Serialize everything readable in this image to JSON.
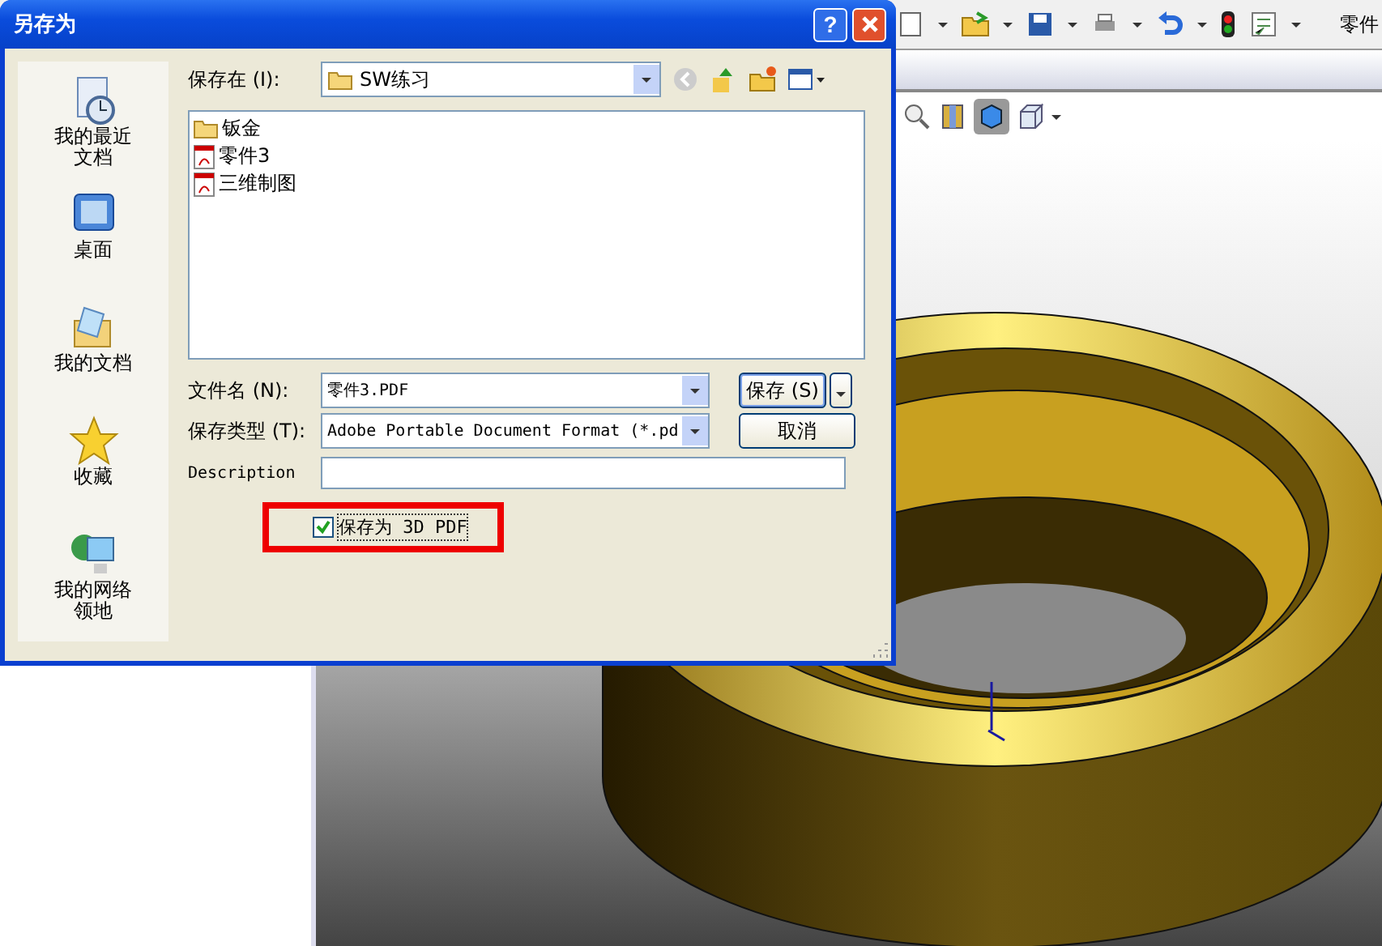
{
  "app": {
    "title_fragment": "零件"
  },
  "dialog": {
    "title": "另存为",
    "help_label": "?",
    "places": [
      {
        "label": "我的最近文档",
        "kind": "recent"
      },
      {
        "label": "桌面",
        "kind": "desktop"
      },
      {
        "label": "我的文档",
        "kind": "documents"
      },
      {
        "label": "收藏",
        "kind": "favorites"
      },
      {
        "label": "我的网络领地",
        "kind": "network"
      }
    ],
    "save_in": {
      "label": "保存在 (I):",
      "value": "SW练习"
    },
    "files": [
      {
        "name": "钣金",
        "kind": "folder"
      },
      {
        "name": "零件3",
        "kind": "pdf"
      },
      {
        "name": "三维制图",
        "kind": "pdf"
      }
    ],
    "file_name": {
      "label": "文件名 (N):",
      "value": "零件3.PDF"
    },
    "file_type": {
      "label": "保存类型 (T):",
      "value": "Adobe Portable Document Format (*.pd"
    },
    "description": {
      "label": "Description"
    },
    "save_3d": {
      "label": "保存为 3D PDF",
      "checked": true,
      "highlighted": true
    },
    "buttons": {
      "save": "保存 (S)",
      "cancel": "取消"
    }
  }
}
